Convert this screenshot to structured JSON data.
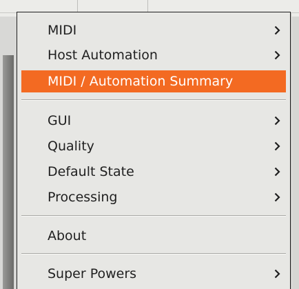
{
  "menu": {
    "items": [
      {
        "label": "MIDI",
        "submenu": true
      },
      {
        "label": "Host Automation",
        "submenu": true
      },
      {
        "label": "MIDI / Automation Summary",
        "submenu": false,
        "highlighted": true
      },
      {
        "label": "GUI",
        "submenu": true
      },
      {
        "label": "Quality",
        "submenu": true
      },
      {
        "label": "Default State",
        "submenu": true
      },
      {
        "label": "Processing",
        "submenu": true
      },
      {
        "label": "About",
        "submenu": false
      },
      {
        "label": "Super Powers",
        "submenu": true
      }
    ],
    "submenu_icon": "chevron-right-icon",
    "highlight_color": "#f36a22"
  }
}
